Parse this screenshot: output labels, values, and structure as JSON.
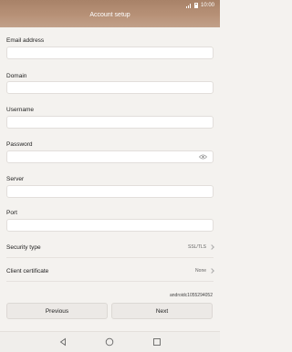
{
  "status_bar": {
    "time": "10:00"
  },
  "header": {
    "title": "Account setup"
  },
  "form": {
    "email_label": "Email address",
    "email_value": "",
    "domain_label": "Domain",
    "domain_value": "",
    "username_label": "Username",
    "username_value": "",
    "password_label": "Password",
    "password_value": "",
    "server_label": "Server",
    "server_value": "",
    "port_label": "Port",
    "port_value": ""
  },
  "settings": {
    "security_label": "Security type",
    "security_value": "SSL/TLS",
    "certificate_label": "Client certificate",
    "certificate_value": "None"
  },
  "device_id": "androidc1055294052",
  "buttons": {
    "previous": "Previous",
    "next": "Next"
  },
  "icons": {
    "back": "back-triangle-icon",
    "home": "home-circle-icon",
    "recents": "recents-square-icon",
    "show_password": "eye-icon"
  },
  "colors": {
    "header": "#b08b70",
    "background": "#f4f2ef"
  }
}
